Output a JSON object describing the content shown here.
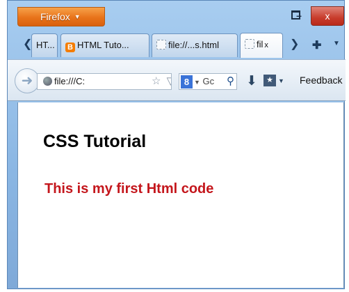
{
  "window": {
    "app_button_label": "Firefox",
    "controls": {
      "minimize": "–",
      "close": "x"
    }
  },
  "tabs": {
    "scroll_left": "❮",
    "items": [
      {
        "label": "HT...",
        "icon": "blogger-icon"
      },
      {
        "label": "HTML Tuto...",
        "icon": "blogger-icon"
      },
      {
        "label": "file://...s.html",
        "icon": "page-icon"
      },
      {
        "label": "fil",
        "icon": "page-icon",
        "active": true
      }
    ],
    "close_label": "x",
    "scroll_right": "❯",
    "new_tab": "✚",
    "list_all": "▼"
  },
  "navbar": {
    "url": "file:///C:",
    "url_tools": "☆ ▽ C",
    "search_placeholder": "Gc",
    "search_engine_label": "8",
    "feedback_label": "Feedback"
  },
  "page": {
    "heading": "CSS Tutorial",
    "text": "This is my first Html code",
    "text_color": "#c4161c"
  },
  "colors": {
    "firefox_orange": "#e8731a",
    "close_red": "#c83c2c",
    "chrome_blue": "#8ab6e3"
  }
}
